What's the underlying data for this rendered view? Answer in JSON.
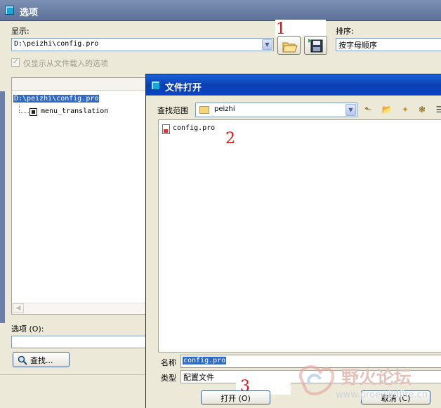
{
  "options_window": {
    "title": "选项",
    "display_label": "显示:",
    "display_value": "D:\\peizhi\\config.pro",
    "sort_label": "排序:",
    "sort_value": "按字母顺序",
    "only_loaded_label": "仅显示从文件载入的选项",
    "tree": {
      "root": "D:\\peizhi\\config.pro",
      "child": "menu_translation"
    },
    "option_label": "选项 (O):",
    "find_button": "查找..."
  },
  "file_dialog": {
    "title": "文件打开",
    "look_in_label": "查找范围",
    "look_in_value": "peizhi",
    "files": [
      "config.pro"
    ],
    "name_label": "名称",
    "name_value": "config.pro",
    "type_label": "类型",
    "type_value": "配置文件",
    "open_button": "打开 (O)",
    "cancel_button": "取消 (C)"
  },
  "annotations": [
    "1",
    "2",
    "3"
  ],
  "watermark": "野火论坛",
  "watermark_sub": "www.proewildfire.cn",
  "colors": {
    "title_inactive": "#6a7ea6",
    "title_active": "#0b43bb",
    "selection": "#316ac5",
    "annotation": "#dd1111"
  }
}
